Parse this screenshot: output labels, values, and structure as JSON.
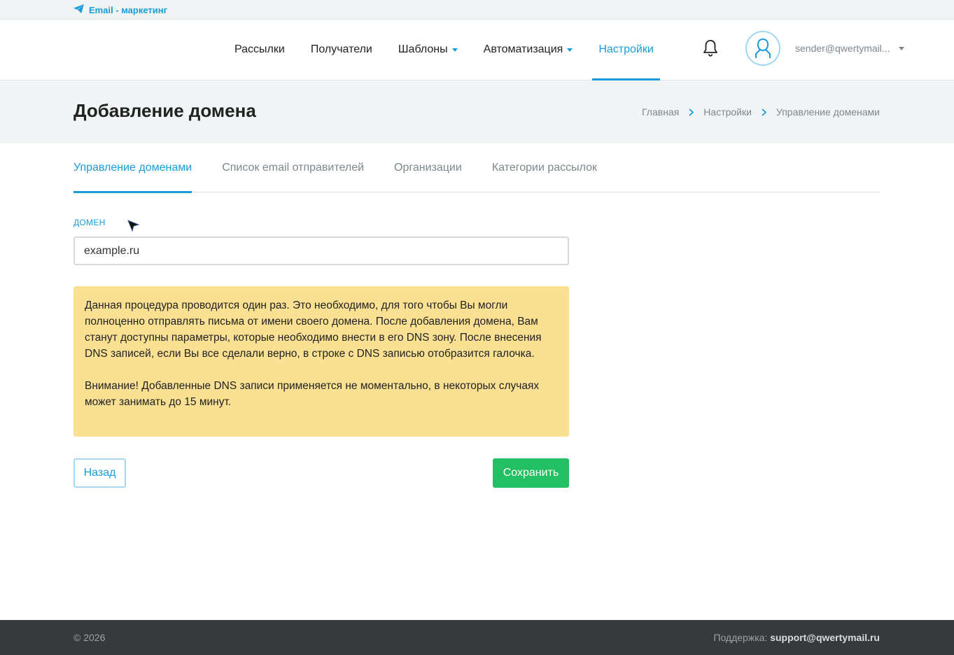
{
  "topbar": {
    "brand": "Email - маркетинг",
    "brand_icon": "paper-plane-icon"
  },
  "nav": {
    "items": [
      {
        "label": "Рассылки",
        "dropdown": false
      },
      {
        "label": "Получатели",
        "dropdown": false
      },
      {
        "label": "Шаблоны",
        "dropdown": true
      },
      {
        "label": "Автоматизация",
        "dropdown": true
      },
      {
        "label": "Настройки",
        "dropdown": false,
        "active": true
      }
    ],
    "user_email": "sender@qwertymail..."
  },
  "page": {
    "title": "Добавление домена",
    "breadcrumbs": [
      "Главная",
      "Настройки",
      "Управление доменами"
    ]
  },
  "tabs": [
    {
      "label": "Управление доменами",
      "active": true
    },
    {
      "label": "Список email отправителей"
    },
    {
      "label": "Организации"
    },
    {
      "label": "Категории рассылок"
    }
  ],
  "form": {
    "domain_label": "ДОМЕН",
    "domain_value": "example.ru",
    "notice_p1": "Данная процедура проводится один раз. Это необходимо, для того чтобы Вы могли полноценно отправлять письма от имени своего домена. После добавления домена, Вам станут доступны параметры, которые необходимо внести в его DNS зону. После внесения DNS записей, если Вы все сделали верно, в строке с DNS записью отобразится галочка.",
    "notice_p2": "Внимание! Добавленные DNS записи применяется не моментально, в некоторых случаях может занимать до 15 минут.",
    "back_label": "Назад",
    "save_label": "Сохранить"
  },
  "footer": {
    "copyright": "© 2026",
    "support_label": "Поддержка:",
    "support_email": "support@qwertymail.ru"
  },
  "colors": {
    "accent": "#1a9cd8",
    "save": "#22c063",
    "notice_bg": "#fae093",
    "footer_bg": "#37393c"
  }
}
